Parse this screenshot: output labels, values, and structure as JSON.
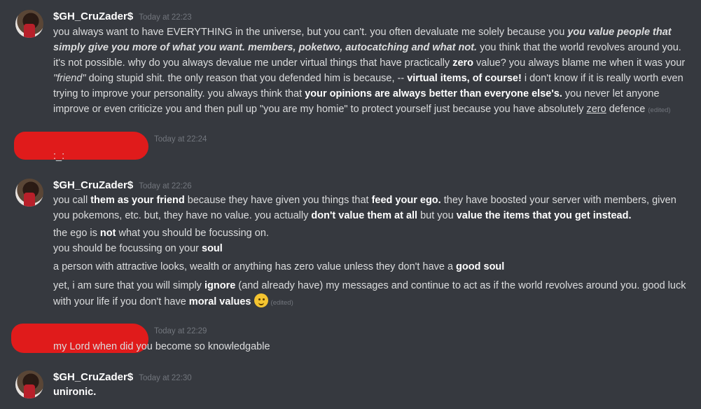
{
  "messages": [
    {
      "username": "$GH_CruZader$",
      "timestamp": "Today at 22:23",
      "p1": [
        "you always want to have EVERYTHING in the universe, but you can't. you often devaluate me solely because you ",
        "you value people that simply give you more of what you want. members, poketwo, autocatching and what not.",
        " you think that the world revolves around you. it's not possible. why do you always devalue me under virtual things that have practically ",
        "zero",
        " value? you always blame me when it was your ",
        "\"friend\"",
        " doing stupid shit. the only reason that you defended him is because, -- ",
        "virtual items, of course!",
        " i don't know if it is really worth even trying to improve your personality. you always think that ",
        "your opinions are always better than everyone else's.",
        " you never let anyone improve or even criticize you and then pull up \"you are my homie\" to protect yourself just because you have absolutely ",
        "zero",
        " defence ",
        "(edited)"
      ]
    },
    {
      "timestamp": "Today at 22:24",
      "text": ":_:"
    },
    {
      "username": "$GH_CruZader$",
      "timestamp": "Today at 22:26",
      "p1": [
        "you call ",
        "them as your friend",
        " because they have given you things that ",
        "feed your ego.",
        " they have boosted your server with members, given you pokemons, etc. but, they have no value. you actually ",
        "don't value them at all",
        " but you ",
        "value the items that you get instead."
      ],
      "p2": [
        "the ego is ",
        "not",
        " what you should be focussing on."
      ],
      "p3": [
        "you should be focussing on your ",
        "soul"
      ],
      "p4": [
        "a person with attractive looks, wealth or anything has zero value unless they don't have a ",
        "good soul"
      ],
      "p5": [
        "yet, i am sure that you will simply ",
        "ignore",
        " (and already have) my messages and continue to act as if the world revolves around you. good luck with your life if you don't have ",
        "moral values",
        " ",
        "(edited)"
      ]
    },
    {
      "timestamp": "Today at 22:29",
      "text": "my Lord when did you become so knowledgable"
    },
    {
      "username": "$GH_CruZader$",
      "timestamp": "Today at 22:30",
      "text": "unironic."
    }
  ]
}
